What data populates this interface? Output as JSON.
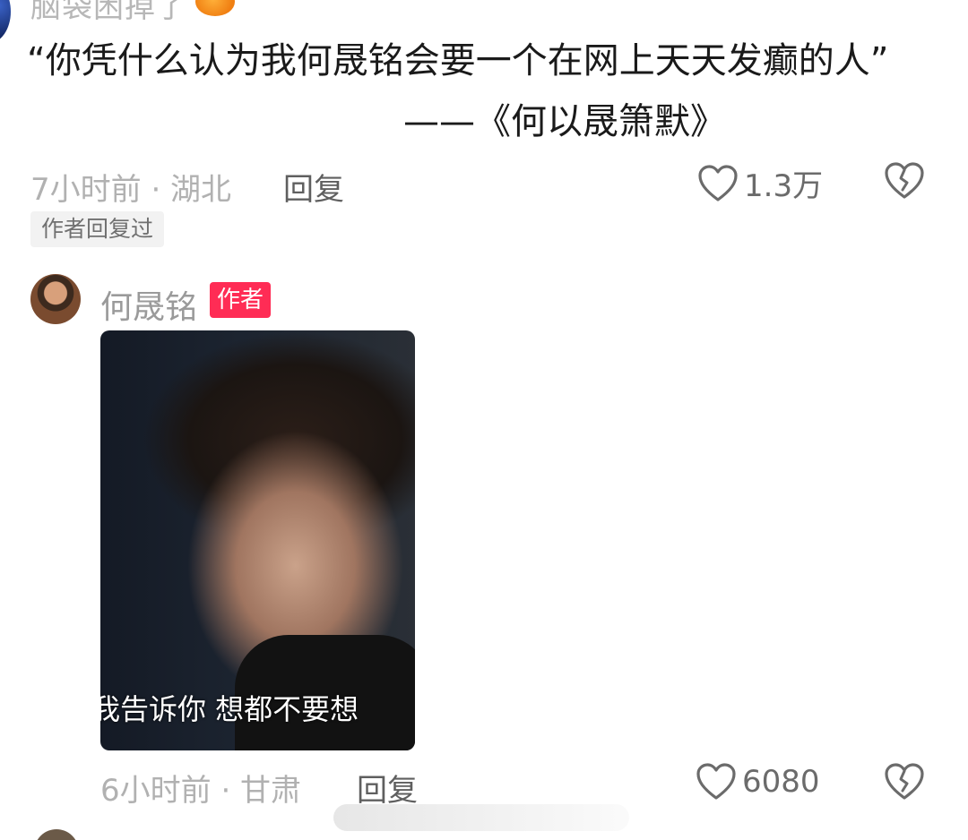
{
  "comment": {
    "username": "脑袋困掉了",
    "text": "“你凭什么认为我何晟铭会要一个在网上天天发癫的人”",
    "signature": "——《何以晟箫默》",
    "time_location": "7小时前 · 湖北",
    "reply_label": "回复",
    "likes": "1.3万",
    "author_replied_tag": "作者回复过"
  },
  "reply": {
    "username": "何晟铭",
    "badge": "作者",
    "image_subtitle": "我告诉你 想都不要想",
    "time_location": "6小时前 · 甘肃",
    "reply_label": "回复",
    "likes": "6080"
  },
  "colors": {
    "badge": "#ff2c55",
    "meta": "#b1b1b1",
    "text": "#1a1a1a"
  }
}
